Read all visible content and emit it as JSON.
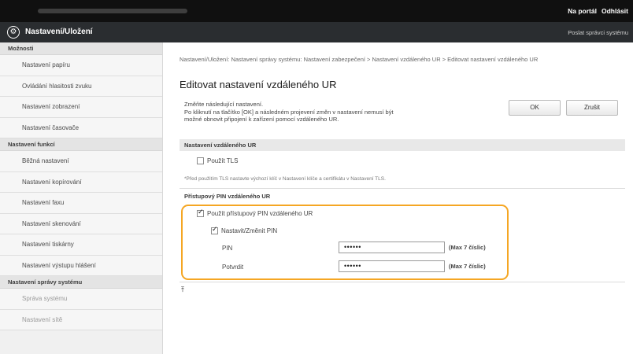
{
  "topbar": {
    "portal_link": "Na portál",
    "logout_link": "Odhlásit"
  },
  "header": {
    "title": "Nastavení/Uložení",
    "right_link": "Poslat správci systému"
  },
  "sidebar": {
    "sections": [
      {
        "heading": "Možnosti",
        "items": [
          "Nastavení papíru",
          "Ovládání hlasitosti zvuku",
          "Nastavení zobrazení",
          "Nastavení časovače"
        ]
      },
      {
        "heading": "Nastavení funkcí",
        "items": [
          "Běžná nastavení",
          "Nastavení kopírování",
          "Nastavení faxu",
          "Nastavení skenování",
          "Nastavení tiskárny",
          "Nastavení výstupu hlášení"
        ]
      },
      {
        "heading": "Nastavení správy systému",
        "items": [
          "Správa systému",
          "Nastavení sítě"
        ]
      }
    ]
  },
  "main": {
    "breadcrumb": "Nastavení/Uložení: Nastavení správy systému: Nastavení zabezpečení > Nastavení vzdáleného UR > Editovat nastavení vzdáleného UR",
    "title": "Editovat nastavení vzdáleného UR",
    "description": [
      "Změňte následující nastavení.",
      "Po kliknutí na tlačítko [OK] a následném projevení změn v nastavení nemusí být",
      "možné obnovit připojení k zařízení pomocí vzdáleného UR."
    ],
    "ok_label": "OK",
    "cancel_label": "Zrušit",
    "section_title": "Nastavení vzdáleného UR",
    "use_tls_label": "Použít TLS",
    "use_tls_checked": false,
    "tls_note": "*Před použitím TLS nastavte výchozí klíč v Nastavení klíče a certifikátu v Nastavení TLS.",
    "pin_subsection_title": "Přístupový PIN vzdáleného UR",
    "use_pin_label": "Použít přístupový PIN vzdáleného UR",
    "use_pin_checked": true,
    "set_pin_label": "Nastavit/Změnit PIN",
    "set_pin_checked": true,
    "pin_label": "PIN",
    "pin_value": "••••••",
    "pin_hint": "(Max 7 číslic)",
    "confirm_label": "Potvrdit",
    "confirm_value": "••••••",
    "confirm_hint": "(Max 7 číslic)"
  },
  "colors": {
    "highlight": "#f5a623",
    "header_bg": "#2a2d30",
    "topbar_bg": "#101010"
  }
}
